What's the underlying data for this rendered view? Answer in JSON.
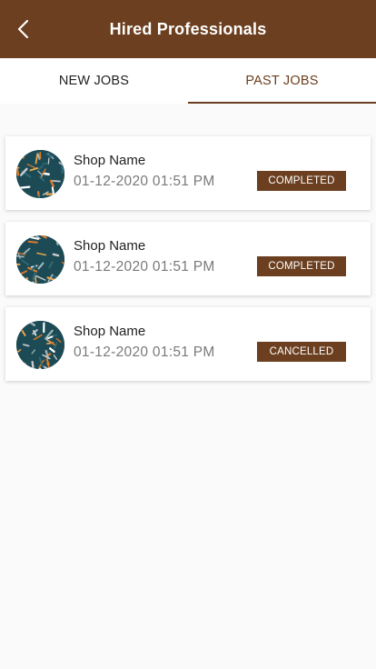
{
  "header": {
    "title": "Hired Professionals",
    "back_icon": "chevron-left-icon"
  },
  "tabs": [
    {
      "label": "NEW JOBS",
      "active": false
    },
    {
      "label": "PAST JOBS",
      "active": true
    }
  ],
  "jobs": [
    {
      "shop_name": "Shop Name",
      "datetime": "01-12-2020 01:51 PM",
      "status": "COMPLETED"
    },
    {
      "shop_name": "Shop Name",
      "datetime": "01-12-2020 01:51 PM",
      "status": "COMPLETED"
    },
    {
      "shop_name": "Shop Name",
      "datetime": "01-12-2020 01:51 PM",
      "status": "CANCELLED"
    }
  ],
  "colors": {
    "primary": "#6b3f1f",
    "background": "#fafafa",
    "card": "#ffffff"
  }
}
